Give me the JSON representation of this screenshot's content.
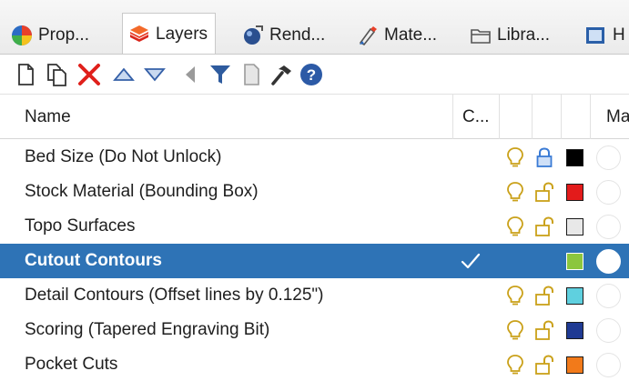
{
  "tabs": [
    {
      "label": "Prop...",
      "icon": "properties-icon"
    },
    {
      "label": "Layers",
      "icon": "layers-icon",
      "active": true
    },
    {
      "label": "Rend...",
      "icon": "render-icon"
    },
    {
      "label": "Mate...",
      "icon": "materials-icon"
    },
    {
      "label": "Libra...",
      "icon": "libraries-icon"
    },
    {
      "label": "H",
      "icon": "help-panel-icon"
    }
  ],
  "toolbar": {
    "buttons": [
      "new-layer-icon",
      "new-sublayer-icon",
      "delete-icon",
      "move-up-icon",
      "move-down-icon",
      "move-to-parent-icon",
      "filter-icon",
      "tools-icon",
      "set-current-icon",
      "help-icon"
    ]
  },
  "header": {
    "name": "Name",
    "current": "C...",
    "material": "Ma"
  },
  "layers": [
    {
      "name": "Bed Size (Do Not Unlock)",
      "current": false,
      "visible": true,
      "locked": true,
      "color": "#000000"
    },
    {
      "name": "Stock Material (Bounding Box)",
      "current": false,
      "visible": true,
      "locked": false,
      "color": "#e31b1b"
    },
    {
      "name": "Topo Surfaces",
      "current": false,
      "visible": true,
      "locked": false,
      "color": "#e8e8e8"
    },
    {
      "name": "Cutout Contours",
      "current": true,
      "visible": false,
      "locked": false,
      "color": "#8cc63e",
      "selected": true
    },
    {
      "name": "Detail Contours (Offset lines by 0.125\")",
      "current": false,
      "visible": true,
      "locked": false,
      "color": "#5fd0df"
    },
    {
      "name": "Scoring (Tapered Engraving Bit)",
      "current": false,
      "visible": true,
      "locked": false,
      "color": "#1f3a93"
    },
    {
      "name": "Pocket Cuts",
      "current": false,
      "visible": true,
      "locked": false,
      "color": "#f27a1a"
    }
  ]
}
